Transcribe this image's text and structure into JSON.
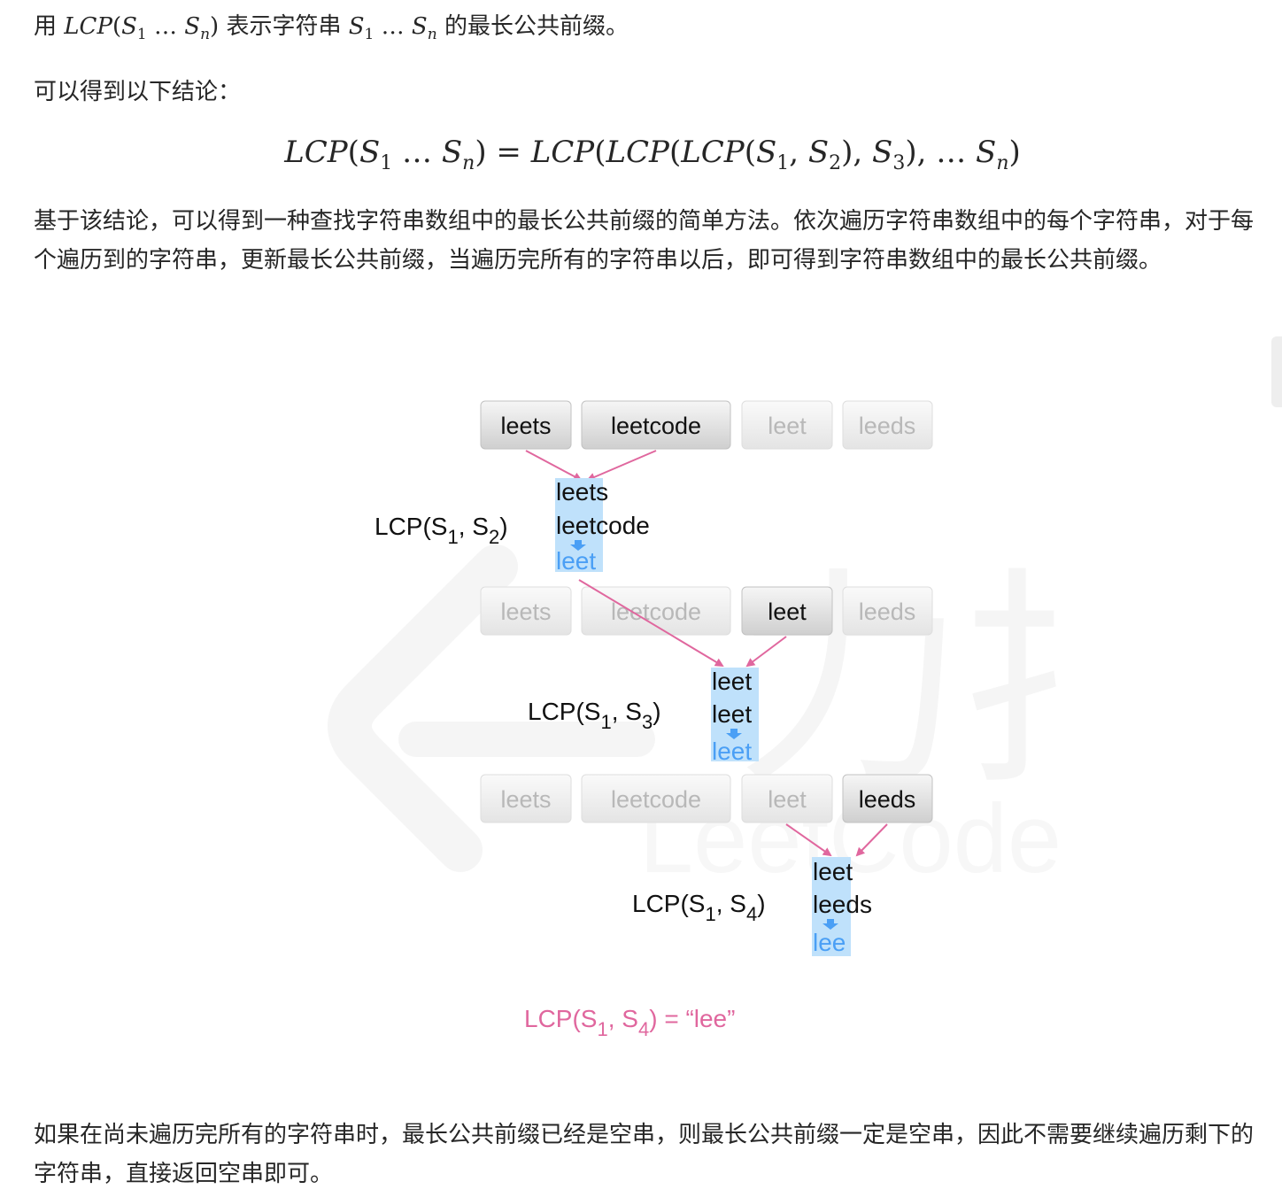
{
  "intro": {
    "prefix": "用",
    "middle": "表示字符串",
    "suffix": "的最长公共前缀。"
  },
  "conclusion_lead": "可以得到以下结论：",
  "method_paragraph": "基于该结论，可以得到一种查找字符串数组中的最长公共前缀的简单方法。依次遍历字符串数组中的每个字符串，对于每个遍历到的字符串，更新最长公共前缀，当遍历完所有的字符串以后，即可得到字符串数组中的最长公共前缀。",
  "closing_paragraph": "如果在尚未遍历完所有的字符串时，最长公共前缀已经是空串，则最长公共前缀一定是空串，因此不需要继续遍历剩下的字符串，直接返回空串即可。",
  "diagram": {
    "strings": [
      "leets",
      "leetcode",
      "leet",
      "leeds"
    ],
    "steps": [
      {
        "lcp_label": "LCP(S",
        "second_index": "2",
        "lines": [
          "leets",
          "leetcode"
        ],
        "common_prefix": "leet",
        "result": "leet"
      },
      {
        "lcp_label": "LCP(S",
        "second_index": "3",
        "lines": [
          "leet",
          "leet"
        ],
        "common_prefix": "leet",
        "result": "leet"
      },
      {
        "lcp_label": "LCP(S",
        "second_index": "4",
        "lines": [
          "leet",
          "leeds"
        ],
        "common_prefix": "lee",
        "result": "lee"
      }
    ],
    "final": {
      "label": "LCP(S",
      "first_index": "1",
      "second_index": "4",
      "equals": "= “lee”"
    },
    "watermark": {
      "brand_text": "LeetCode",
      "cn_text": "力扣"
    },
    "colors": {
      "accent": "#e0679e",
      "highlight": "#bfe1fb",
      "result_text": "#4a9ff5",
      "arrow_blue": "#4a9ff5"
    }
  }
}
